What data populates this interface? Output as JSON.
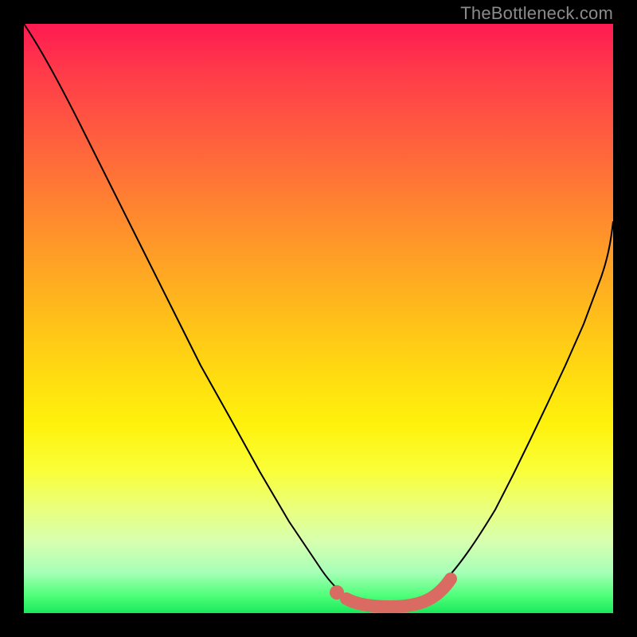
{
  "attribution": "TheBottleneck.com",
  "colors": {
    "curve": "#000000",
    "highlight": "#d96b63",
    "gradient_stops": [
      "#ff1a52",
      "#ff7a34",
      "#ffd712",
      "#f9ff3a",
      "#1ae85a"
    ]
  },
  "chart_data": {
    "type": "line",
    "title": "",
    "xlabel": "",
    "ylabel": "",
    "xlim": [
      0,
      1
    ],
    "ylim": [
      0,
      1
    ],
    "x": [
      0.0,
      0.02,
      0.05,
      0.1,
      0.15,
      0.2,
      0.25,
      0.3,
      0.35,
      0.4,
      0.45,
      0.5,
      0.53,
      0.56,
      0.59,
      0.62,
      0.65,
      0.68,
      0.71,
      0.74,
      0.77,
      0.8,
      0.83,
      0.86,
      0.89,
      0.92,
      0.95,
      0.98,
      1.0
    ],
    "series": [
      {
        "name": "curve",
        "values": [
          1.0,
          0.97,
          0.92,
          0.82,
          0.72,
          0.62,
          0.52,
          0.42,
          0.33,
          0.24,
          0.155,
          0.08,
          0.045,
          0.025,
          0.015,
          0.01,
          0.01,
          0.012,
          0.02,
          0.04,
          0.075,
          0.125,
          0.185,
          0.255,
          0.335,
          0.42,
          0.51,
          0.605,
          0.665
        ]
      }
    ],
    "highlight_range_x": [
      0.53,
      0.72
    ],
    "highlight_dot_x": 0.53,
    "annotations": []
  }
}
